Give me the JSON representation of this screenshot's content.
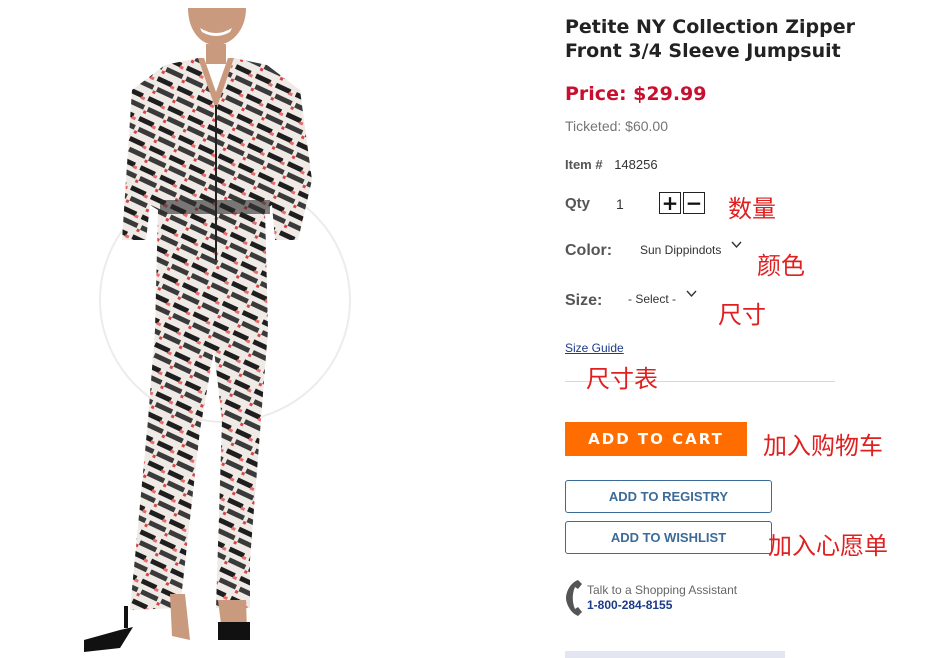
{
  "product": {
    "title": "Petite NY Collection Zipper\nFront 3/4 Sleeve Jumpsuit",
    "price": "Price: $29.99",
    "ticketed": "Ticketed: $60.00",
    "item_label": "Item #",
    "item_number": "148256"
  },
  "options": {
    "qty_label": "Qty",
    "qty_value": "1",
    "qty_plus": "+",
    "qty_minus": "−",
    "color_label": "Color:",
    "color_value": "Sun Dippindots",
    "size_label": "Size:",
    "size_value": "- Select -",
    "size_guide": "Size Guide"
  },
  "actions": {
    "add_to_cart": "ADD TO CART",
    "add_to_registry": "ADD TO REGISTRY",
    "add_to_wishlist": "ADD TO WISHLIST"
  },
  "assistant": {
    "line1": "Talk to a Shopping Assistant",
    "phone": "1-800-284-8155"
  },
  "annotations": {
    "qty": "数量",
    "color": "颜色",
    "size": "尺寸",
    "size_guide": "尺寸表",
    "add_to_cart": "加入购物车",
    "add_to_wishlist": "加入心愿单"
  },
  "colors": {
    "price": "#c8102e",
    "cart_button": "#ff6c00",
    "outline_button": "#3c6a99",
    "annotation": "#e02020"
  }
}
